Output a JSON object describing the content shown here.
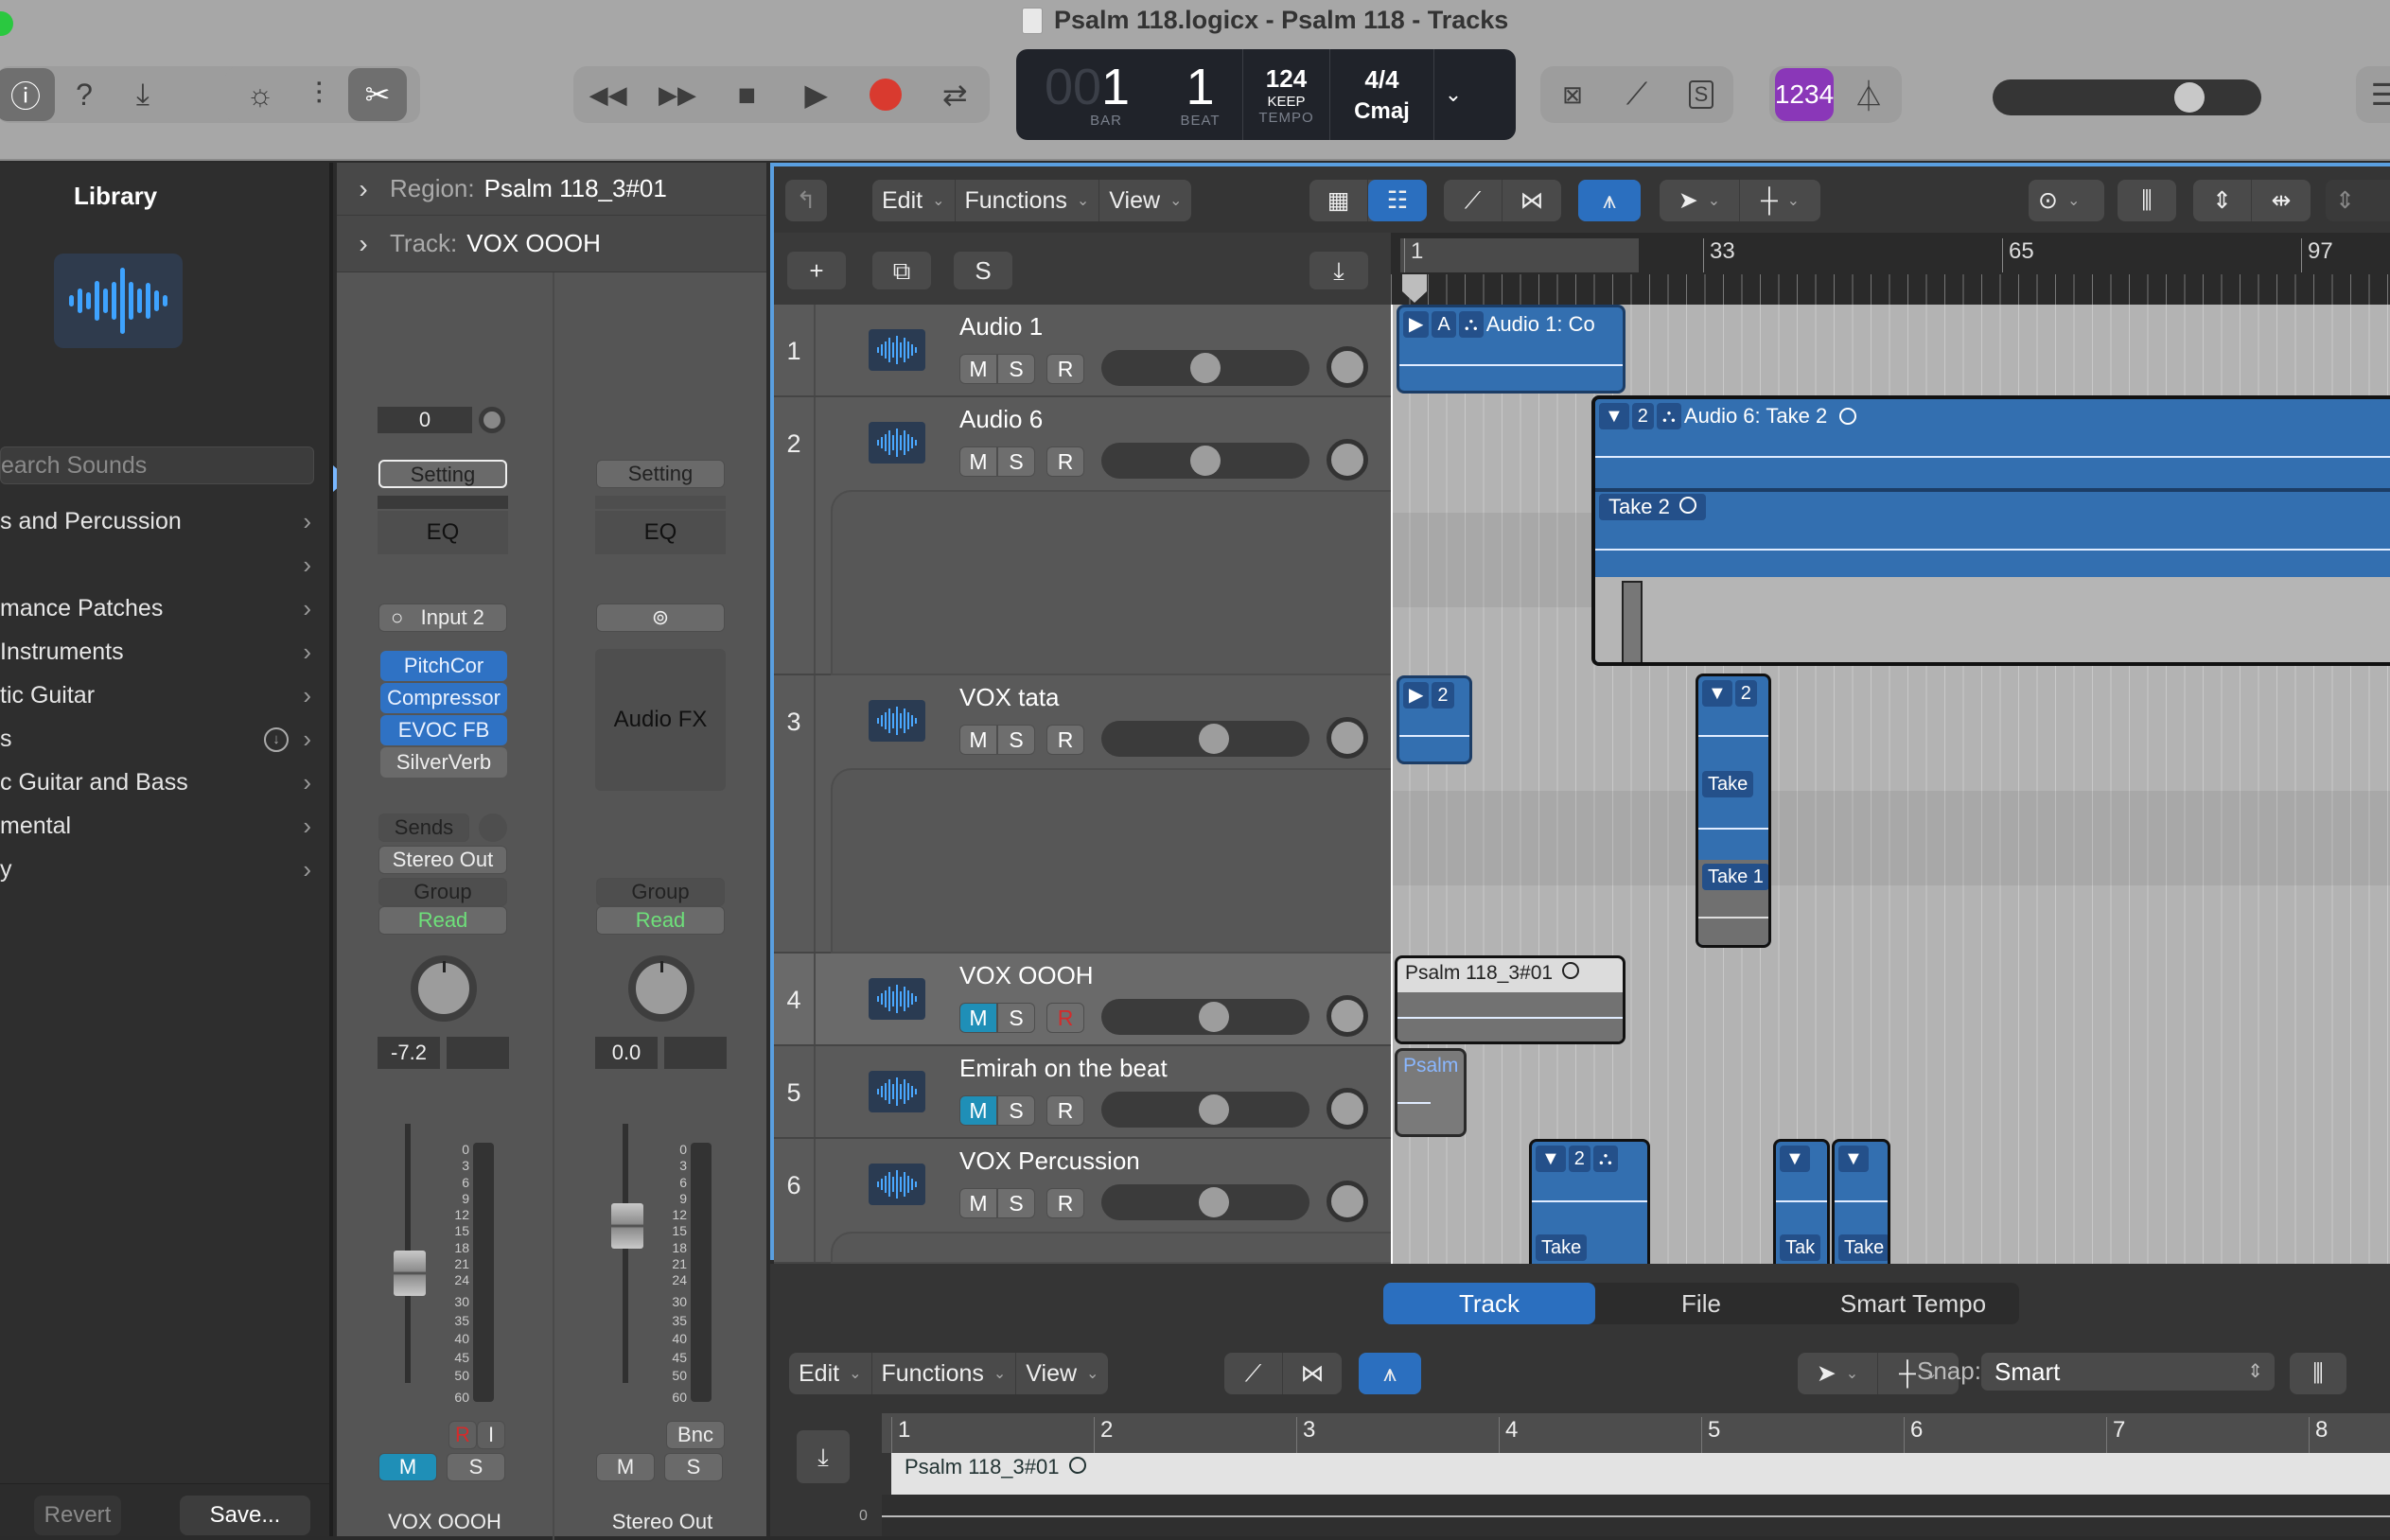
{
  "window": {
    "title": "Psalm 118.logicx - Psalm 118 - Tracks"
  },
  "toolbar": {
    "view_buttons": [
      {
        "icon": "info-icon",
        "active": true
      },
      {
        "icon": "help-icon",
        "active": false
      },
      {
        "icon": "download-inbox-icon",
        "active": false
      }
    ],
    "mode_buttons": [
      {
        "icon": "smart-controls-icon",
        "active": false
      },
      {
        "icon": "mixer-icon",
        "active": false
      },
      {
        "icon": "scissors-icon",
        "active": true
      }
    ],
    "transport": [
      {
        "icon": "rewind-icon",
        "glyph": "◀◀"
      },
      {
        "icon": "fast-forward-icon",
        "glyph": "▶▶"
      },
      {
        "icon": "stop-icon",
        "glyph": "■"
      },
      {
        "icon": "play-icon",
        "glyph": "▶"
      },
      {
        "icon": "record-icon",
        "glyph": ""
      },
      {
        "icon": "cycle-icon",
        "glyph": "⇄"
      }
    ],
    "lcd": {
      "bar_dim": "00",
      "bar": "1",
      "beat": "1",
      "bar_label": "BAR",
      "beat_label": "BEAT",
      "tempo": "124",
      "tempo_mode": "KEEP",
      "tempo_label": "TEMPO",
      "signature": "4/4",
      "key": "Cmaj"
    },
    "tools": [
      {
        "icon": "replace-icon",
        "glyph": "⊠"
      },
      {
        "icon": "tuner-icon",
        "glyph": "⟋"
      },
      {
        "icon": "solo-icon",
        "glyph": "S"
      }
    ],
    "count_in": "1234",
    "metronome_icon": "metronome-icon",
    "master_volume": 0.77
  },
  "library": {
    "title": "Library",
    "search_placeholder": "earch Sounds",
    "items": [
      {
        "label": "s and Percussion",
        "download": false
      },
      {
        "label": "",
        "download": false
      },
      {
        "label": "mance Patches",
        "download": false
      },
      {
        "label": " Instruments",
        "download": false
      },
      {
        "label": "tic Guitar",
        "download": false
      },
      {
        "label": "s",
        "download": true
      },
      {
        "label": "c Guitar and Bass",
        "download": false
      },
      {
        "label": "mental",
        "download": false
      },
      {
        "label": "y",
        "download": false
      }
    ],
    "revert_label": "Revert",
    "save_label": "Save..."
  },
  "inspector": {
    "region_label": "Region:",
    "region_value": "Psalm 118_3#01",
    "track_label": "Track:",
    "track_value": "VOX OOOH",
    "strip1": {
      "gain": "0",
      "setting": "Setting",
      "eq": "EQ",
      "input": "Input 2",
      "plugins": [
        {
          "name": "PitchCor",
          "active": true
        },
        {
          "name": "Compressor",
          "active": true
        },
        {
          "name": "EVOC FB",
          "active": true
        },
        {
          "name": "SilverVerb",
          "active": false
        }
      ],
      "sends": "Sends",
      "output": "Stereo Out",
      "group": "Group",
      "automation": "Read",
      "volume": "-7.2",
      "record": "R",
      "input_monitor": "I",
      "mute": "M",
      "solo": "S",
      "name": "VOX OOOH"
    },
    "strip2": {
      "setting": "Setting",
      "eq": "EQ",
      "audio_fx": "Audio FX",
      "group": "Group",
      "automation": "Read",
      "volume": "0.0",
      "bounce": "Bnc",
      "mute": "M",
      "solo": "S",
      "name": "Stereo Out"
    },
    "meter_scale": [
      "0",
      "3",
      "6",
      "9",
      "12",
      "15",
      "18",
      "21",
      "24",
      "30",
      "35",
      "40",
      "45",
      "50",
      "60"
    ]
  },
  "tracks_toolbar": {
    "menus": [
      "Edit",
      "Functions",
      "View"
    ],
    "add_label": "+",
    "solo_label": "S"
  },
  "ruler": {
    "marks": [
      "1",
      "33",
      "65",
      "97"
    ]
  },
  "tracks": [
    {
      "num": "1",
      "name": "Audio 1",
      "mute": false,
      "rec_red": false,
      "volume": 0.5
    },
    {
      "num": "2",
      "name": "Audio 6",
      "mute": false,
      "rec_red": false,
      "volume": 0.5
    },
    {
      "num": "3",
      "name": "VOX tata",
      "mute": false,
      "rec_red": false,
      "volume": 0.55
    },
    {
      "num": "4",
      "name": "VOX OOOH",
      "mute": true,
      "rec_red": true,
      "volume": 0.55
    },
    {
      "num": "5",
      "name": "Emirah on the beat",
      "mute": true,
      "rec_red": false,
      "volume": 0.55
    },
    {
      "num": "6",
      "name": "VOX Percussion",
      "mute": false,
      "rec_red": false,
      "volume": 0.55
    }
  ],
  "msr": {
    "m": "M",
    "s": "S",
    "r": "R"
  },
  "regions": {
    "audio1": {
      "flags": [
        "▶",
        "A",
        "⛬"
      ],
      "name": "Audio 1: Co"
    },
    "audio6": {
      "flags": [
        "▼",
        "2",
        "⛬"
      ],
      "name": "Audio 6: Take 2"
    },
    "audio6_take": "Take 2",
    "voxtata1": {
      "flags": [
        "▶",
        "2"
      ]
    },
    "voxtata2": {
      "flags": [
        "▼",
        "2"
      ]
    },
    "voxtata_take": "Take",
    "voxtata_take1": "Take 1",
    "vox_oooh": "Psalm 118_3#01",
    "emirah": "Psalm",
    "perc1": {
      "flags": [
        "▼",
        "2",
        "⛬"
      ]
    },
    "perc_take": "Take",
    "perc2_take": "Tak",
    "perc3_take": "Take",
    "perc_arrow": "▼"
  },
  "editor": {
    "tabs": [
      {
        "label": "Track",
        "active": true
      },
      {
        "label": "File",
        "active": false
      },
      {
        "label": "Smart Tempo",
        "active": false
      }
    ],
    "menus": [
      "Edit",
      "Functions",
      "View"
    ],
    "snap_label": "Snap:",
    "snap_value": "Smart",
    "ruler": [
      "1",
      "2",
      "3",
      "4",
      "5",
      "6",
      "7",
      "8"
    ],
    "region_name": "Psalm 118_3#01",
    "zero_label": "0"
  }
}
